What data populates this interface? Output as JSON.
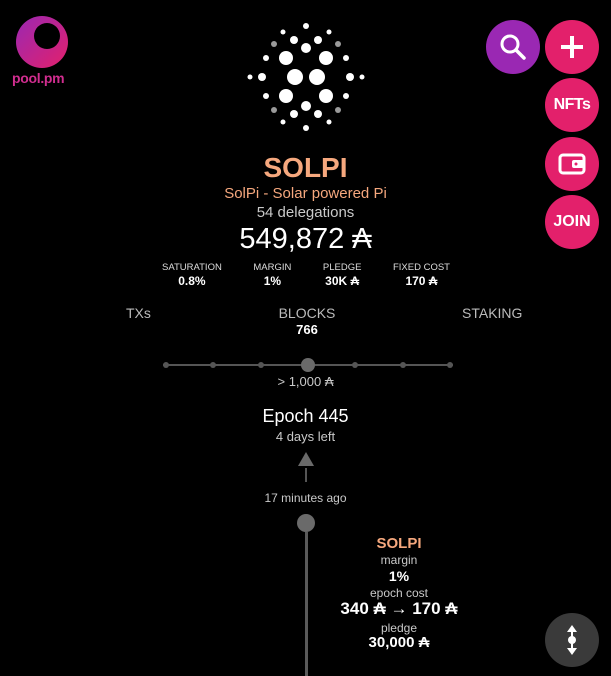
{
  "brand": {
    "name": "pool.pm",
    "pink": "#d12d8f",
    "purple": "#9a28b3"
  },
  "nav": {
    "search_icon": "search-icon",
    "add_icon": "plus-icon",
    "nfts_label": "NFTs",
    "wallet_icon": "wallet-icon",
    "join_label": "JOIN",
    "scroll_icon": "vertical-scroll-icon"
  },
  "pool": {
    "ticker": "SOLPI",
    "name": "SolPi - Solar powered Pi",
    "delegations": "54 delegations",
    "live_stake": "549,872 ₳",
    "stats": [
      {
        "label": "SATURATION",
        "value": "0.8%"
      },
      {
        "label": "MARGIN",
        "value": "1%"
      },
      {
        "label": "PLEDGE",
        "value": "30K ₳"
      },
      {
        "label": "FIXED COST",
        "value": "170 ₳"
      }
    ]
  },
  "tabs": {
    "txs": "TXs",
    "blocks": "BLOCKS",
    "blocks_count": "766",
    "staking": "STAKING"
  },
  "slider": {
    "value_label": "> 1,000 ₳",
    "stops": 7,
    "selected_stop": 3
  },
  "epoch": {
    "title": "Epoch 445",
    "remaining": "4 days left"
  },
  "timeline": {
    "time": "17 minutes ago",
    "event": {
      "ticker": "SOLPI",
      "margin_label": "margin",
      "margin_value": "1%",
      "cost_label": "epoch cost",
      "cost_value": "340 ₳ → 170 ₳",
      "pledge_label": "pledge",
      "pledge_value": "30,000 ₳"
    }
  }
}
